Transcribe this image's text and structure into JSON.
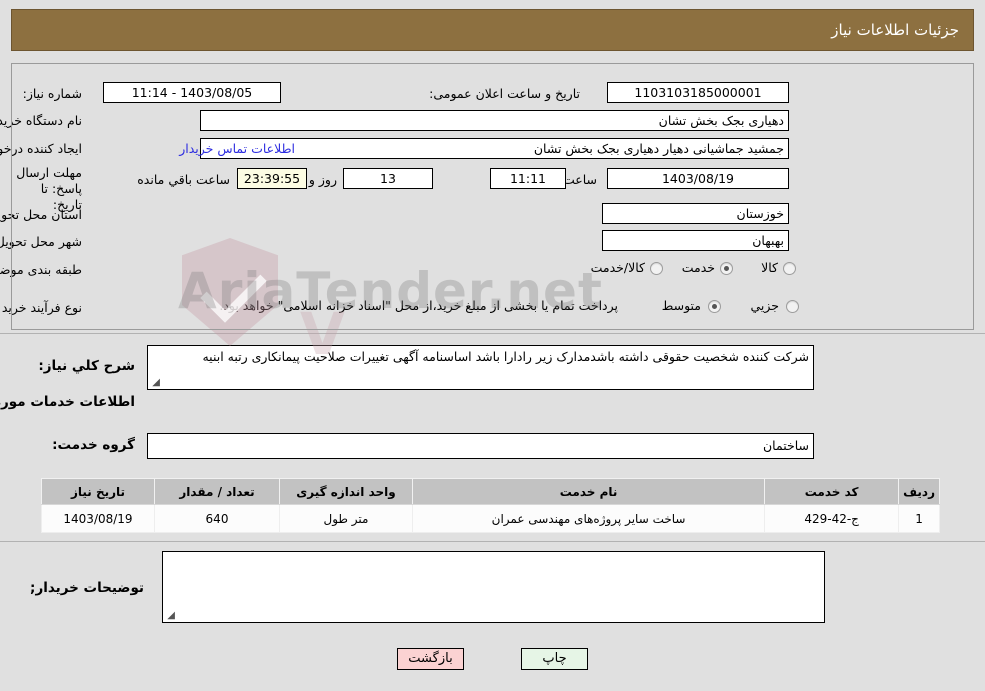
{
  "header": {
    "title": "جزئیات اطلاعات نیاز",
    "bar_color": "#8d7040"
  },
  "watermark": {
    "text": "AriaTender.net",
    "letter": "V"
  },
  "form": {
    "need_number_label": "شماره نیاز:",
    "need_number_value": "1103103185000001",
    "announce_datetime_label": "تاریخ و ساعت اعلان عمومی:",
    "announce_datetime_value": "1403/08/05 - 11:14",
    "buyer_org_label": "نام دستگاه خریدار:",
    "buyer_org_value": "دهیاری بجک بخش تشان",
    "creator_label": "ایجاد کننده درخواست:",
    "creator_value": "جمشید جماشیانی دهیار دهیاری بجک بخش تشان",
    "contact_link": "اطلاعات تماس خریدار",
    "deadline_label": "مهلت ارسال پاسخ: تا تاریخ:",
    "deadline_date": "1403/08/19",
    "hour_label": "ساعت",
    "deadline_time": "11:11",
    "remaining_days": "13",
    "days_and_label": "روز و",
    "remaining_time": "23:39:55",
    "remaining_suffix": "ساعت باقي مانده",
    "province_label": "استان محل تحویل:",
    "province_value": "خوزستان",
    "city_label": "شهر محل تحویل:",
    "city_value": "بهبهان",
    "category_label": "طبقه بندی موضوعی:",
    "category_options": [
      {
        "label": "کالا",
        "selected": false
      },
      {
        "label": "خدمت",
        "selected": true
      },
      {
        "label": "کالا/خدمت",
        "selected": false
      }
    ],
    "purchase_type_label": "نوع فرآیند خرید :",
    "purchase_type_options": [
      {
        "label": "جزیي",
        "selected": false
      },
      {
        "label": "متوسط",
        "selected": true
      }
    ],
    "treasury_note": "پرداخت تمام یا بخشی از مبلغ خرید،از محل \"اسناد خزانه اسلامی\" خواهد بود."
  },
  "description": {
    "label": "شرح کلي نياز:",
    "value": "شرکت  کننده شخصیت حقوقی داشته  باشدمدارک زیر رادارا باشد اساسنامه آگهی تغییرات صلاحیت پیمانکاری رتبه ابنیه"
  },
  "services_section": {
    "heading": "اطلاعات خدمات مورد نیاز",
    "service_group_label": "گروه خدمت:",
    "service_group_value": "ساختمان"
  },
  "table": {
    "columns": [
      "ردیف",
      "کد خدمت",
      "نام خدمت",
      "واحد اندازه گیری",
      "تعداد / مقدار",
      "تاریخ نیاز"
    ],
    "rows": [
      {
        "row_no": "1",
        "service_code": "ج-42-429",
        "service_name": "ساخت سایر پروژه‌های مهندسی عمران",
        "unit": "متر طول",
        "quantity": "640",
        "need_date": "1403/08/19"
      }
    ]
  },
  "buyer_notes": {
    "label": "توضیحات خریدار;",
    "value": ""
  },
  "buttons": {
    "print": "چاپ",
    "back": "بازگشت"
  }
}
